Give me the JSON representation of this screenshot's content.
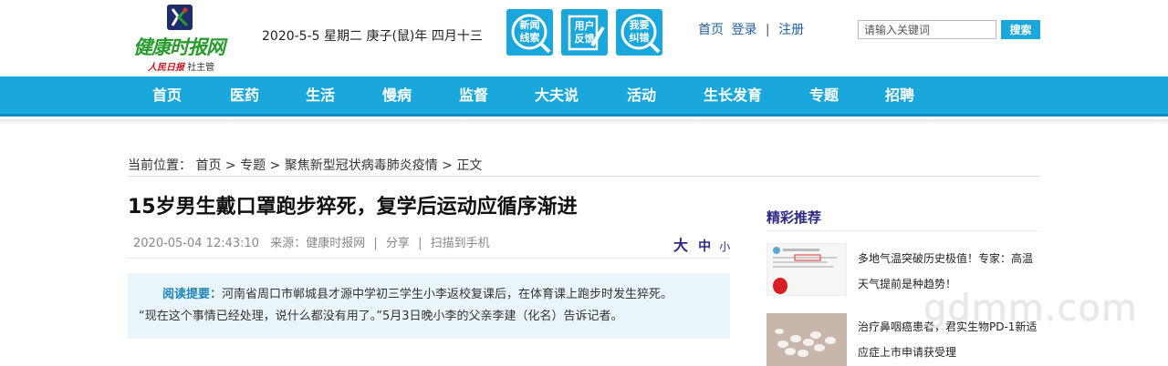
{
  "header": {
    "logo_text": "健康时报网",
    "logo_sub_red": "人民日报",
    "logo_sub": "社主管",
    "date": "2020-5-5 星期二 庚子(鼠)年 四月十三",
    "badges": [
      {
        "line1": "新闻",
        "line2": "线索",
        "icon": "magnifier-icon"
      },
      {
        "line1": "用户",
        "line2": "反馈",
        "icon": "pencil-clipboard-icon"
      },
      {
        "line1": "我要",
        "line2": "纠错",
        "icon": "magnifier-icon"
      }
    ],
    "links": {
      "home": "首页",
      "login": "登录",
      "register": "注册",
      "sep": "|"
    },
    "search": {
      "placeholder": "请输入关键词",
      "button": "搜索"
    },
    "accent": "#1aa8dc"
  },
  "nav": [
    "首页",
    "医药",
    "生活",
    "慢病",
    "监督",
    "大夫说",
    "活动",
    "生长发育",
    "专题",
    "招聘"
  ],
  "breadcrumb": {
    "prefix": "当前位置：",
    "items": [
      "首页",
      "专题",
      "聚焦新型冠状病毒肺炎疫情",
      "正文"
    ],
    "sep": ">"
  },
  "article": {
    "title": "15岁男生戴口罩跑步猝死，复学后运动应循序渐进",
    "datetime": "2020-05-04 12:43:10",
    "source": "来源：健康时报网",
    "share": "分享",
    "scan": "扫描到手机",
    "font_sizes": {
      "big": "大",
      "mid": "中",
      "small": "小"
    },
    "summary_label": "阅读提要：",
    "summary_line1": "河南省周口市郸城县才源中学初三学生小李返校复课后，在体育课上跑步时发生猝死。",
    "summary_line2": "“现在这个事情已经处理，说什么都没有用了。”5月3日晚小李的父亲李建（化名）告诉记者。"
  },
  "sidebar": {
    "title": "精彩推荐",
    "items": [
      {
        "text": "多地气温突破历史极值！专家：高温天气提前是种趋势！"
      },
      {
        "text": "治疗鼻咽癌患者，君实生物PD-1新适应症上市申请获受理"
      }
    ]
  },
  "watermark": "gdmm.com"
}
